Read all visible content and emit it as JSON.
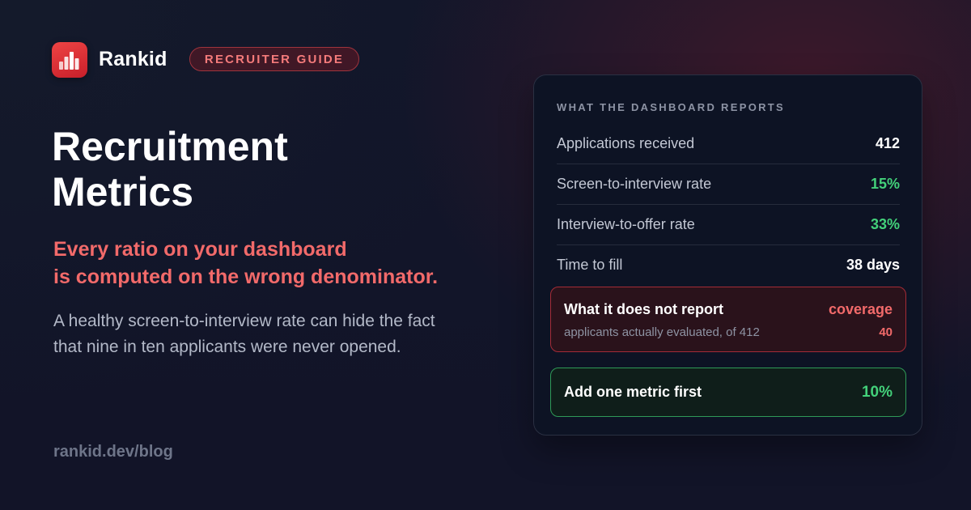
{
  "header": {
    "logo_icon": "bar-chart-icon",
    "brand": "Rankid",
    "badge": "RECRUITER GUIDE",
    "accent_color": "#e53935"
  },
  "hero": {
    "title_line1": "Recruitment",
    "title_line2": "Metrics",
    "subtitle_line1": "Every ratio on your dashboard",
    "subtitle_line2": "is computed on the wrong denominator.",
    "description_line1": "A healthy screen-to-interview rate can hide the fact",
    "description_line2": "that nine in ten applicants were never opened."
  },
  "footer": {
    "url": "rankid.dev/blog"
  },
  "card": {
    "heading": "WHAT THE DASHBOARD REPORTS",
    "rows": [
      {
        "label": "Applications received",
        "value": "412"
      },
      {
        "label": "Screen-to-interview rate",
        "value": "15%"
      },
      {
        "label": "Interview-to-offer rate",
        "value": "33%"
      },
      {
        "label": "Time to fill",
        "value": "38 days"
      }
    ],
    "missing": {
      "title": "What it does not report",
      "tag": "coverage",
      "detail": "applicants actually evaluated, of 412",
      "count": "40"
    },
    "recommend": {
      "title": "Add one metric first",
      "value": "10%"
    }
  }
}
